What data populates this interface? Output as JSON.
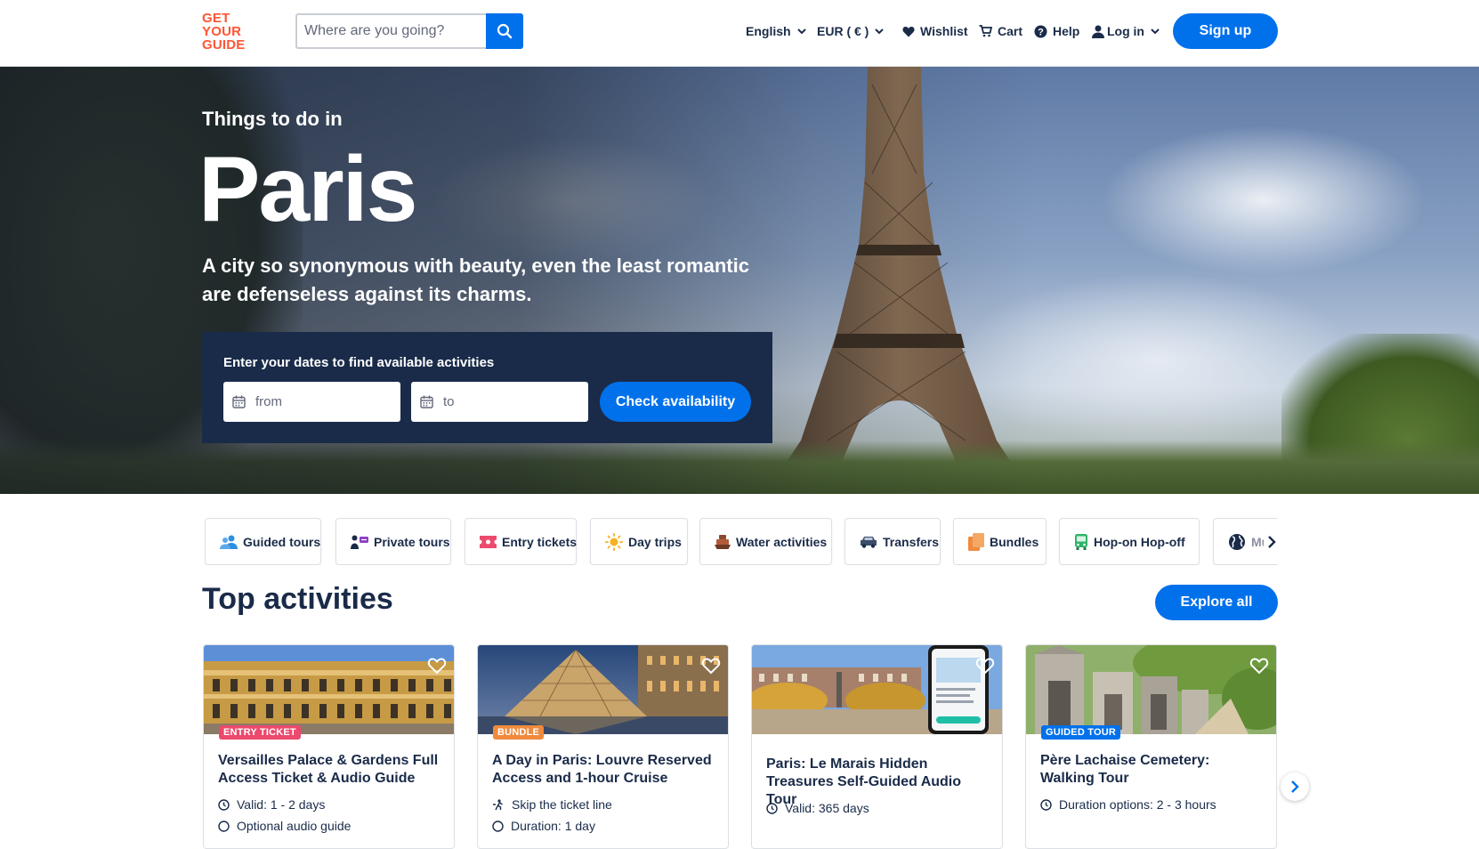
{
  "brand": {
    "logo_lines": [
      "GET",
      "YOUR",
      "GUIDE"
    ],
    "accent": "#ff5533",
    "primary": "#0071eb",
    "navy": "#1a2b49"
  },
  "search": {
    "placeholder": "Where are you going?",
    "icon": "search-icon"
  },
  "nav": {
    "language": "English",
    "currency": "EUR ( € )",
    "wishlist": "Wishlist",
    "cart": "Cart",
    "help": "Help",
    "login": "Log in",
    "signup": "Sign up"
  },
  "hero": {
    "pre_title": "Things to do in",
    "title": "Paris",
    "description": "A city so synonymous with beauty, even the least romantic are defenseless against its charms.",
    "dates_label": "Enter your dates to find available activities",
    "from_placeholder": "from",
    "to_placeholder": "to",
    "check_button": "Check availability"
  },
  "categories": [
    {
      "label": "Guided tours",
      "icon": "people-icon"
    },
    {
      "label": "Private tours",
      "icon": "private-guide-icon"
    },
    {
      "label": "Entry tickets",
      "icon": "ticket-icon"
    },
    {
      "label": "Day trips",
      "icon": "sun-icon"
    },
    {
      "label": "Water activities",
      "icon": "boat-icon"
    },
    {
      "label": "Transfers",
      "icon": "car-icon"
    },
    {
      "label": "Bundles",
      "icon": "bundle-icon"
    },
    {
      "label": "Hop-on Hop-off",
      "icon": "bus-icon"
    },
    {
      "label": "Mul",
      "icon": "globe-icon"
    }
  ],
  "top_activities": {
    "title": "Top activities",
    "explore_button": "Explore all",
    "cards": [
      {
        "badge": "ENTRY TICKET",
        "badge_color": "#eb4a6e",
        "title": "Versailles Palace & Gardens Full Access Ticket & Audio Guide",
        "meta": [
          "Valid: 1 - 2 days",
          "Optional audio guide"
        ]
      },
      {
        "badge": "BUNDLE",
        "badge_color": "#f08a3c",
        "title": "A Day in Paris: Louvre Reserved Access and 1-hour Cruise",
        "meta": [
          "Skip the ticket line",
          "Duration: 1 day"
        ]
      },
      {
        "badge": "",
        "badge_color": "",
        "title": "Paris: Le Marais Hidden Treasures Self-Guided Audio Tour",
        "meta": [
          "Valid: 365 days"
        ]
      },
      {
        "badge": "GUIDED TOUR",
        "badge_color": "#0071eb",
        "title": "Père Lachaise Cemetery: Walking Tour",
        "meta": [
          "Duration options: 2 - 3 hours"
        ]
      }
    ]
  }
}
